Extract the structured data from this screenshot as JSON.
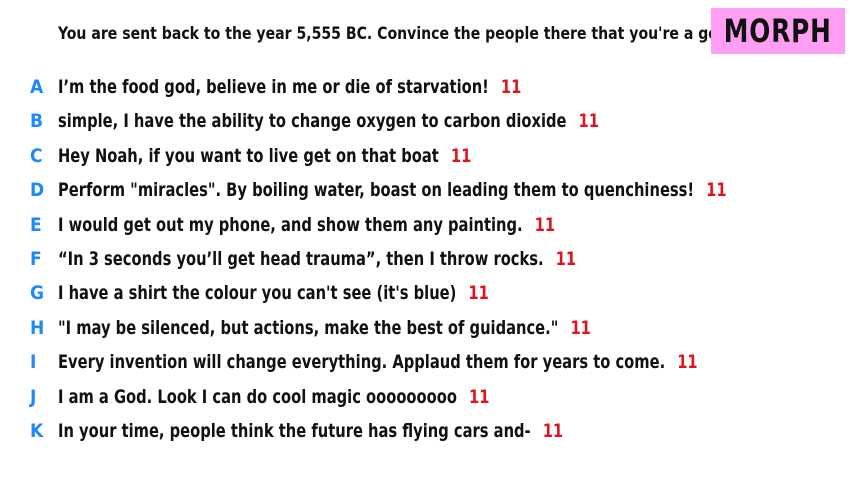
{
  "prompt": "You are sent back to the year 5,555 BC. Convince the people there that you're a god.",
  "badge": "MORPH",
  "colors": {
    "letter": "#1e88ff",
    "score": "#e0141f",
    "badge_bg": "#ff9ef2"
  },
  "answers": [
    {
      "letter": "A",
      "text": "I’m the food god, believe in me or die of starvation!",
      "score": "11"
    },
    {
      "letter": "B",
      "text": "simple, I have the ability to change oxygen to carbon dioxide",
      "score": "11"
    },
    {
      "letter": "C",
      "text": "Hey Noah, if you want to live get on that boat",
      "score": "11"
    },
    {
      "letter": "D",
      "text": "Perform \"miracles\". By boiling water, boast on leading them to quenchiness!",
      "score": "11"
    },
    {
      "letter": "E",
      "text": "I would get out my phone, and show them any painting.",
      "score": "11"
    },
    {
      "letter": "F",
      "text": "“In 3 seconds you’ll get head trauma”, then I throw rocks.",
      "score": "11"
    },
    {
      "letter": "G",
      "text": "I have a shirt the colour you can't see (it's blue)",
      "score": "11"
    },
    {
      "letter": "H",
      "text": "\"I may be silenced, but actions, make the best of guidance.\"",
      "score": "11"
    },
    {
      "letter": "I",
      "text": "Every invention will change everything. Applaud them for years to come.",
      "score": "11"
    },
    {
      "letter": "J",
      "text": "I am a God. Look I can do cool magic ooooooooo",
      "score": "11"
    },
    {
      "letter": "K",
      "text": "In your time, people think the future has flying cars and-",
      "score": "11"
    }
  ]
}
